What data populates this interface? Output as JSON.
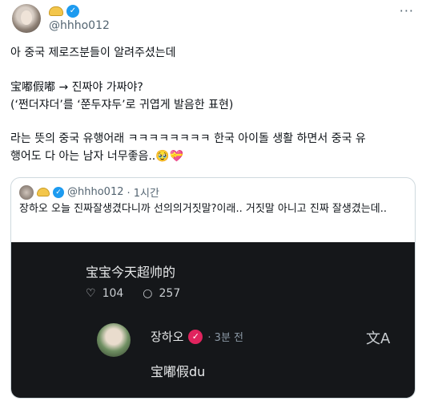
{
  "author": {
    "display_name_icon": "dumpling-emoji",
    "handle": "@hhho012"
  },
  "tweet": {
    "line1": "아 중국 제로즈분들이 알려주셨는데",
    "line2": "宝嘟假嘟 → 진짜야 가짜야?",
    "line3": "(‘쩐더쟈더’를 ‘쭌두쟈두’로 귀엽게 발음한 표현)",
    "line4": "라는 뜻의 중국 유행어래 ㅋㅋㅋㅋㅋㅋㅋㅋ 한국 아이돌 생활 하면서 중국 유",
    "line5": "행어도 다 아는 남자 너무좋음..🥹💝"
  },
  "quote": {
    "handle": "@hhho012",
    "time": "· 1시간",
    "text": "장하오 오늘 진짜잘생겼다니까 선의의거짓말?이래.. 거짓말 아니고 진짜 잘생겼는데..",
    "image": {
      "post_text": "宝宝今天超帅的",
      "likes": "104",
      "comments": "257",
      "reply_name": "장하오",
      "reply_time": "· 3분 전",
      "reply_text": "宝嘟假du"
    }
  },
  "more_label": "···"
}
